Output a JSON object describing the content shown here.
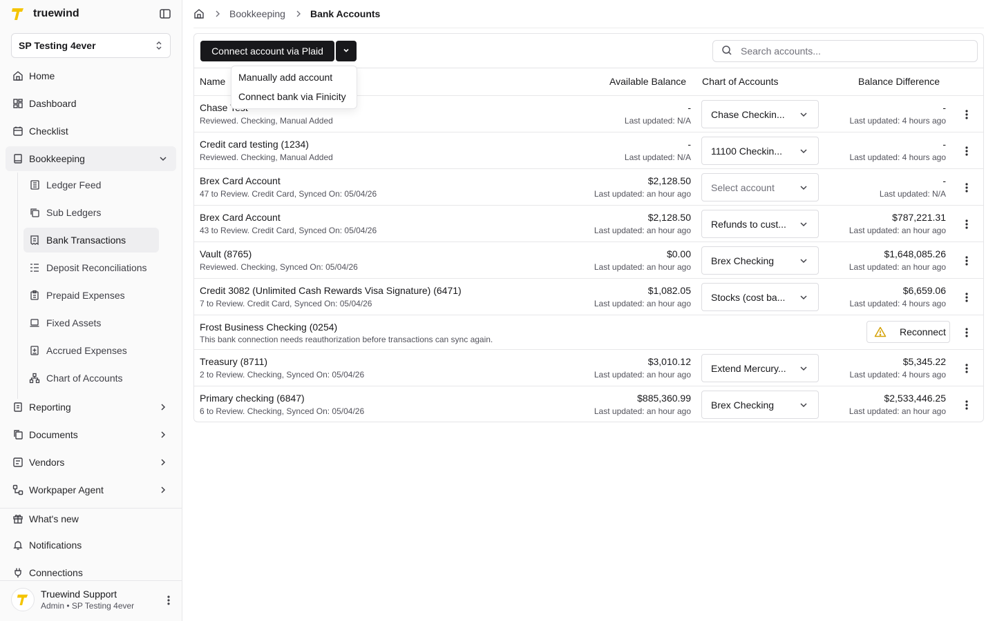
{
  "app": {
    "name": "truewind",
    "brand_color": "#f4c400"
  },
  "org_selector": {
    "value": "SP Testing 4ever"
  },
  "nav": {
    "home": "Home",
    "dashboard": "Dashboard",
    "checklist": "Checklist",
    "bookkeeping": "Bookkeeping",
    "bookkeeping_children": [
      "Ledger Feed",
      "Sub Ledgers",
      "Bank Transactions",
      "Deposit Reconciliations",
      "Prepaid Expenses",
      "Fixed Assets",
      "Accrued Expenses",
      "Chart of Accounts"
    ],
    "active_child": "Bank Transactions",
    "reporting": "Reporting",
    "documents": "Documents",
    "vendors": "Vendors",
    "workpaper_agent": "Workpaper Agent",
    "whats_new": "What's new",
    "notifications": "Notifications",
    "connections": "Connections"
  },
  "user": {
    "name": "Truewind Support",
    "role": "Admin • SP Testing 4ever"
  },
  "breadcrumb": {
    "section": "Bookkeeping",
    "current": "Bank Accounts"
  },
  "toolbar": {
    "connect_label": "Connect account via Plaid",
    "search_placeholder": "Search accounts..."
  },
  "dropdown_menu": {
    "items": [
      "Manually add account",
      "Connect bank via Finicity"
    ]
  },
  "table": {
    "columns": {
      "name": "Name",
      "available_balance": "Available Balance",
      "chart_of_accounts": "Chart of Accounts",
      "balance_difference": "Balance Difference"
    },
    "rows": [
      {
        "name": "Chase Test",
        "detail": "Reviewed. Checking, Manual Added",
        "balance": "-",
        "balance_updated": "Last updated: N/A",
        "coa": "Chase Checkin...",
        "diff": "-",
        "diff_updated": "Last updated: 4 hours ago"
      },
      {
        "name": "Credit card testing (1234)",
        "detail": "Reviewed. Checking, Manual Added",
        "balance": "-",
        "balance_updated": "Last updated: N/A",
        "coa": "11100 Checkin...",
        "diff": "-",
        "diff_updated": "Last updated: 4 hours ago"
      },
      {
        "name": "Brex Card Account",
        "detail": "47 to Review. Credit Card, Synced On: 05/04/26",
        "balance": "$2,128.50",
        "balance_updated": "Last updated: an hour ago",
        "coa": "Select account",
        "diff": "-",
        "diff_updated": "Last updated: N/A"
      },
      {
        "name": "Brex Card Account",
        "detail": "43 to Review. Credit Card, Synced On: 05/04/26",
        "balance": "$2,128.50",
        "balance_updated": "Last updated: an hour ago",
        "coa": "Refunds to cust...",
        "diff": "$787,221.31",
        "diff_updated": "Last updated: an hour ago"
      },
      {
        "name": "Vault (8765)",
        "detail": "Reviewed. Checking, Synced On: 05/04/26",
        "balance": "$0.00",
        "balance_updated": "Last updated: an hour ago",
        "coa": "Brex Checking",
        "diff": "$1,648,085.26",
        "diff_updated": "Last updated: an hour ago"
      },
      {
        "name": "Credit 3082 (Unlimited Cash Rewards Visa Signature) (6471)",
        "detail": "7 to Review. Credit Card, Synced On: 05/04/26",
        "balance": "$1,082.05",
        "balance_updated": "Last updated: an hour ago",
        "coa": "Stocks (cost ba...",
        "diff": "$6,659.06",
        "diff_updated": "Last updated: 4 hours ago"
      },
      {
        "name": "Frost Business Checking (0254)",
        "detail": "This bank connection needs reauthorization before transactions can sync again.",
        "reconnect_label": "Reconnect"
      },
      {
        "name": "Treasury (8711)",
        "detail": "2 to Review. Checking, Synced On: 05/04/26",
        "balance": "$3,010.12",
        "balance_updated": "Last updated: an hour ago",
        "coa": "Extend Mercury...",
        "diff": "$5,345.22",
        "diff_updated": "Last updated: 4 hours ago"
      },
      {
        "name": "Primary checking (6847)",
        "detail": "6 to Review. Checking, Synced On: 05/04/26",
        "balance": "$885,360.99",
        "balance_updated": "Last updated: an hour ago",
        "coa": "Brex Checking",
        "diff": "$2,533,446.25",
        "diff_updated": "Last updated: an hour ago"
      }
    ]
  }
}
